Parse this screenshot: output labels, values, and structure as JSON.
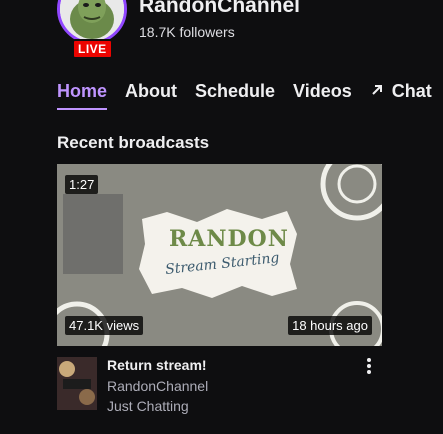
{
  "channel": {
    "name": "RandonChannel",
    "followers": "18.7K followers",
    "live_label": "LIVE"
  },
  "tabs": [
    {
      "label": "Home",
      "active": true
    },
    {
      "label": "About"
    },
    {
      "label": "Schedule"
    },
    {
      "label": "Videos"
    },
    {
      "label": "Chat",
      "icon": "arrow-up-right-icon"
    }
  ],
  "section": {
    "title": "Recent broadcasts"
  },
  "broadcast": {
    "duration": "1:27",
    "views": "47.1K views",
    "time_ago": "18 hours ago",
    "title": "Return stream!",
    "channel": "RandonChannel",
    "category": "Just Chatting",
    "thumbnail_text": "Stream Starting",
    "thumbnail_logo": "RANDON"
  },
  "colors": {
    "accent": "#bf94ff",
    "live": "#eb0400",
    "background": "#0e0e10"
  }
}
